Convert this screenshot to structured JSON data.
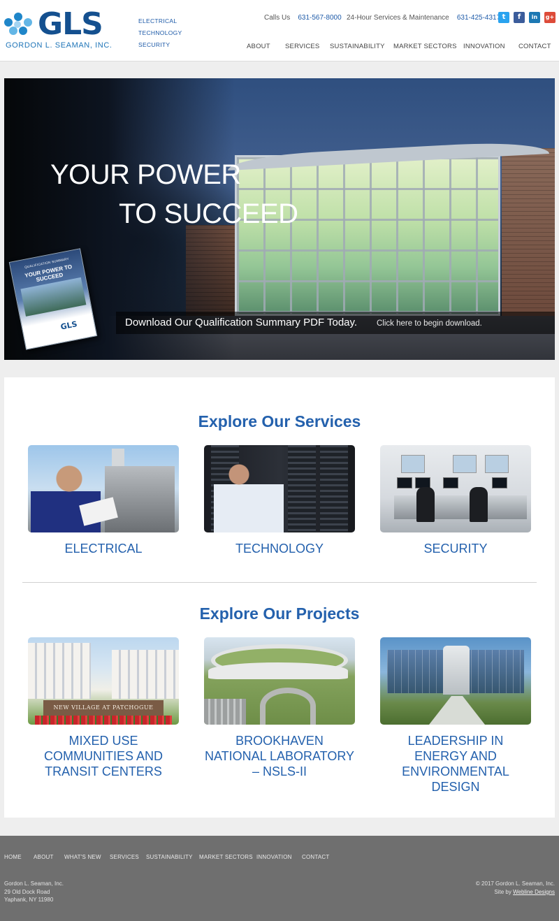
{
  "header": {
    "logo_word": "GLS",
    "logo_sub": "GORDON L. SEAMAN, INC.",
    "tagline": [
      "ELECTRICAL",
      "TECHNOLOGY",
      "SECURITY"
    ],
    "calls_label": "Calls Us",
    "calls_phone": "631-567-8000",
    "service_label": "24-Hour Services & Maintenance",
    "service_phone": "631-425-4317",
    "social": [
      {
        "icon": "twitter-icon",
        "glyph": "t",
        "color": "#2aa3ef"
      },
      {
        "icon": "facebook-icon",
        "glyph": "f",
        "color": "#3b5c9b"
      },
      {
        "icon": "linkedin-icon",
        "glyph": "in",
        "color": "#1c78b3"
      },
      {
        "icon": "googleplus-icon",
        "glyph": "g+",
        "color": "#dd4b39"
      }
    ],
    "nav": [
      "ABOUT",
      "SERVICES",
      "SUSTAINABILITY",
      "MARKET SECTORS",
      "INNOVATION",
      "CONTACT"
    ]
  },
  "hero": {
    "title_line1": "YOUR POWER",
    "title_line2": "TO SUCCEED",
    "cta": "Download Our Qualification Summary PDF Today.",
    "cta_link": "Click here to begin download.",
    "brochure_header": "QUALIFICATION SUMMARY",
    "brochure_title": "YOUR POWER TO SUCCEED",
    "brochure_logo": "GLS"
  },
  "services": {
    "title": "Explore Our Services",
    "items": [
      "ELECTRICAL",
      "TECHNOLOGY",
      "SECURITY"
    ]
  },
  "projects": {
    "title": "Explore Our Projects",
    "items": [
      "MIXED USE COMMUNITIES AND TRANSIT CENTERS",
      "BROOKHAVEN NATIONAL LABORATORY – NSLS-II",
      "LEADERSHIP IN ENERGY AND ENVIRONMENTAL DESIGN"
    ],
    "sign_text": "NEW VILLAGE AT PATCHOGUE"
  },
  "footer": {
    "nav": [
      "HOME",
      "ABOUT",
      "WHAT'S NEW",
      "SERVICES",
      "SUSTAINABILITY",
      "MARKET SECTORS",
      "INNOVATION",
      "CONTACT"
    ],
    "address": [
      "Gordon L. Seaman, Inc.",
      "29 Old Dock Road",
      "Yaphank, NY 11980"
    ],
    "copyright": "© 2017 Gordon L. Seaman, Inc.",
    "credit_prefix": "Site by ",
    "credit_link": "Webline Designs"
  },
  "colors": {
    "brand_blue": "#14508f",
    "link_blue": "#2461ad",
    "footer_bg": "#6f6f6f"
  }
}
